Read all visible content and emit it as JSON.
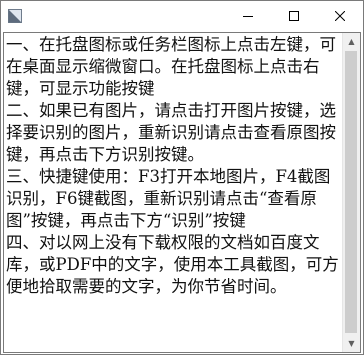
{
  "window": {
    "title": "",
    "controls": {
      "minimize": "—",
      "maximize": "☐",
      "close": "✕"
    }
  },
  "content": {
    "text": "一、在托盘图标或任务栏图标上点击左键，可在桌面显示缩微窗口。在托盘图标上点击右键，可显示功能按键\n二、如果已有图片，请点击打开图片按键，选择要识别的图片，重新识别请点击查看原图按键，再点击下方识别按键。\n三、快捷键使用：F3打开本地图片，F4截图识别，F6键截图，重新识别请点击“查看原图”按键，再点击下方“识别”按键\n四、对以网上没有下载权限的文档如百度文库，或PDF中的文字，使用本工具截图，可方便地拾取需要的文字，为你节省时间。"
  },
  "scrollbar": {
    "up_arrow": "▲",
    "down_arrow": "▼"
  }
}
